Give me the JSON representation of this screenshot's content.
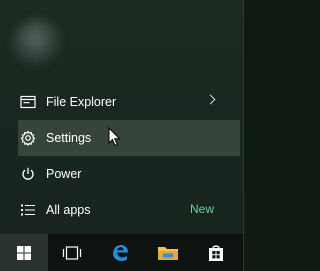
{
  "menu": {
    "items": [
      {
        "label": "File Explorer",
        "icon": "file-explorer-icon",
        "has_submenu": true
      },
      {
        "label": "Settings",
        "icon": "gear-icon",
        "hovered": true
      },
      {
        "label": "Power",
        "icon": "power-icon"
      },
      {
        "label": "All apps",
        "icon": "all-apps-icon",
        "badge": "New"
      }
    ]
  },
  "taskbar": {
    "items": [
      {
        "icon": "windows-start-icon",
        "active": true
      },
      {
        "icon": "task-view-icon"
      },
      {
        "icon": "edge-browser-icon"
      },
      {
        "icon": "file-explorer-folder-icon"
      },
      {
        "icon": "store-icon"
      }
    ]
  },
  "colors": {
    "accent_new": "#6bd0a2",
    "hover_bg": "#36443b",
    "taskbar_bg": "#0e130f",
    "edge_blue": "#1e8fe1",
    "folder_yellow": "#f3c24d"
  }
}
